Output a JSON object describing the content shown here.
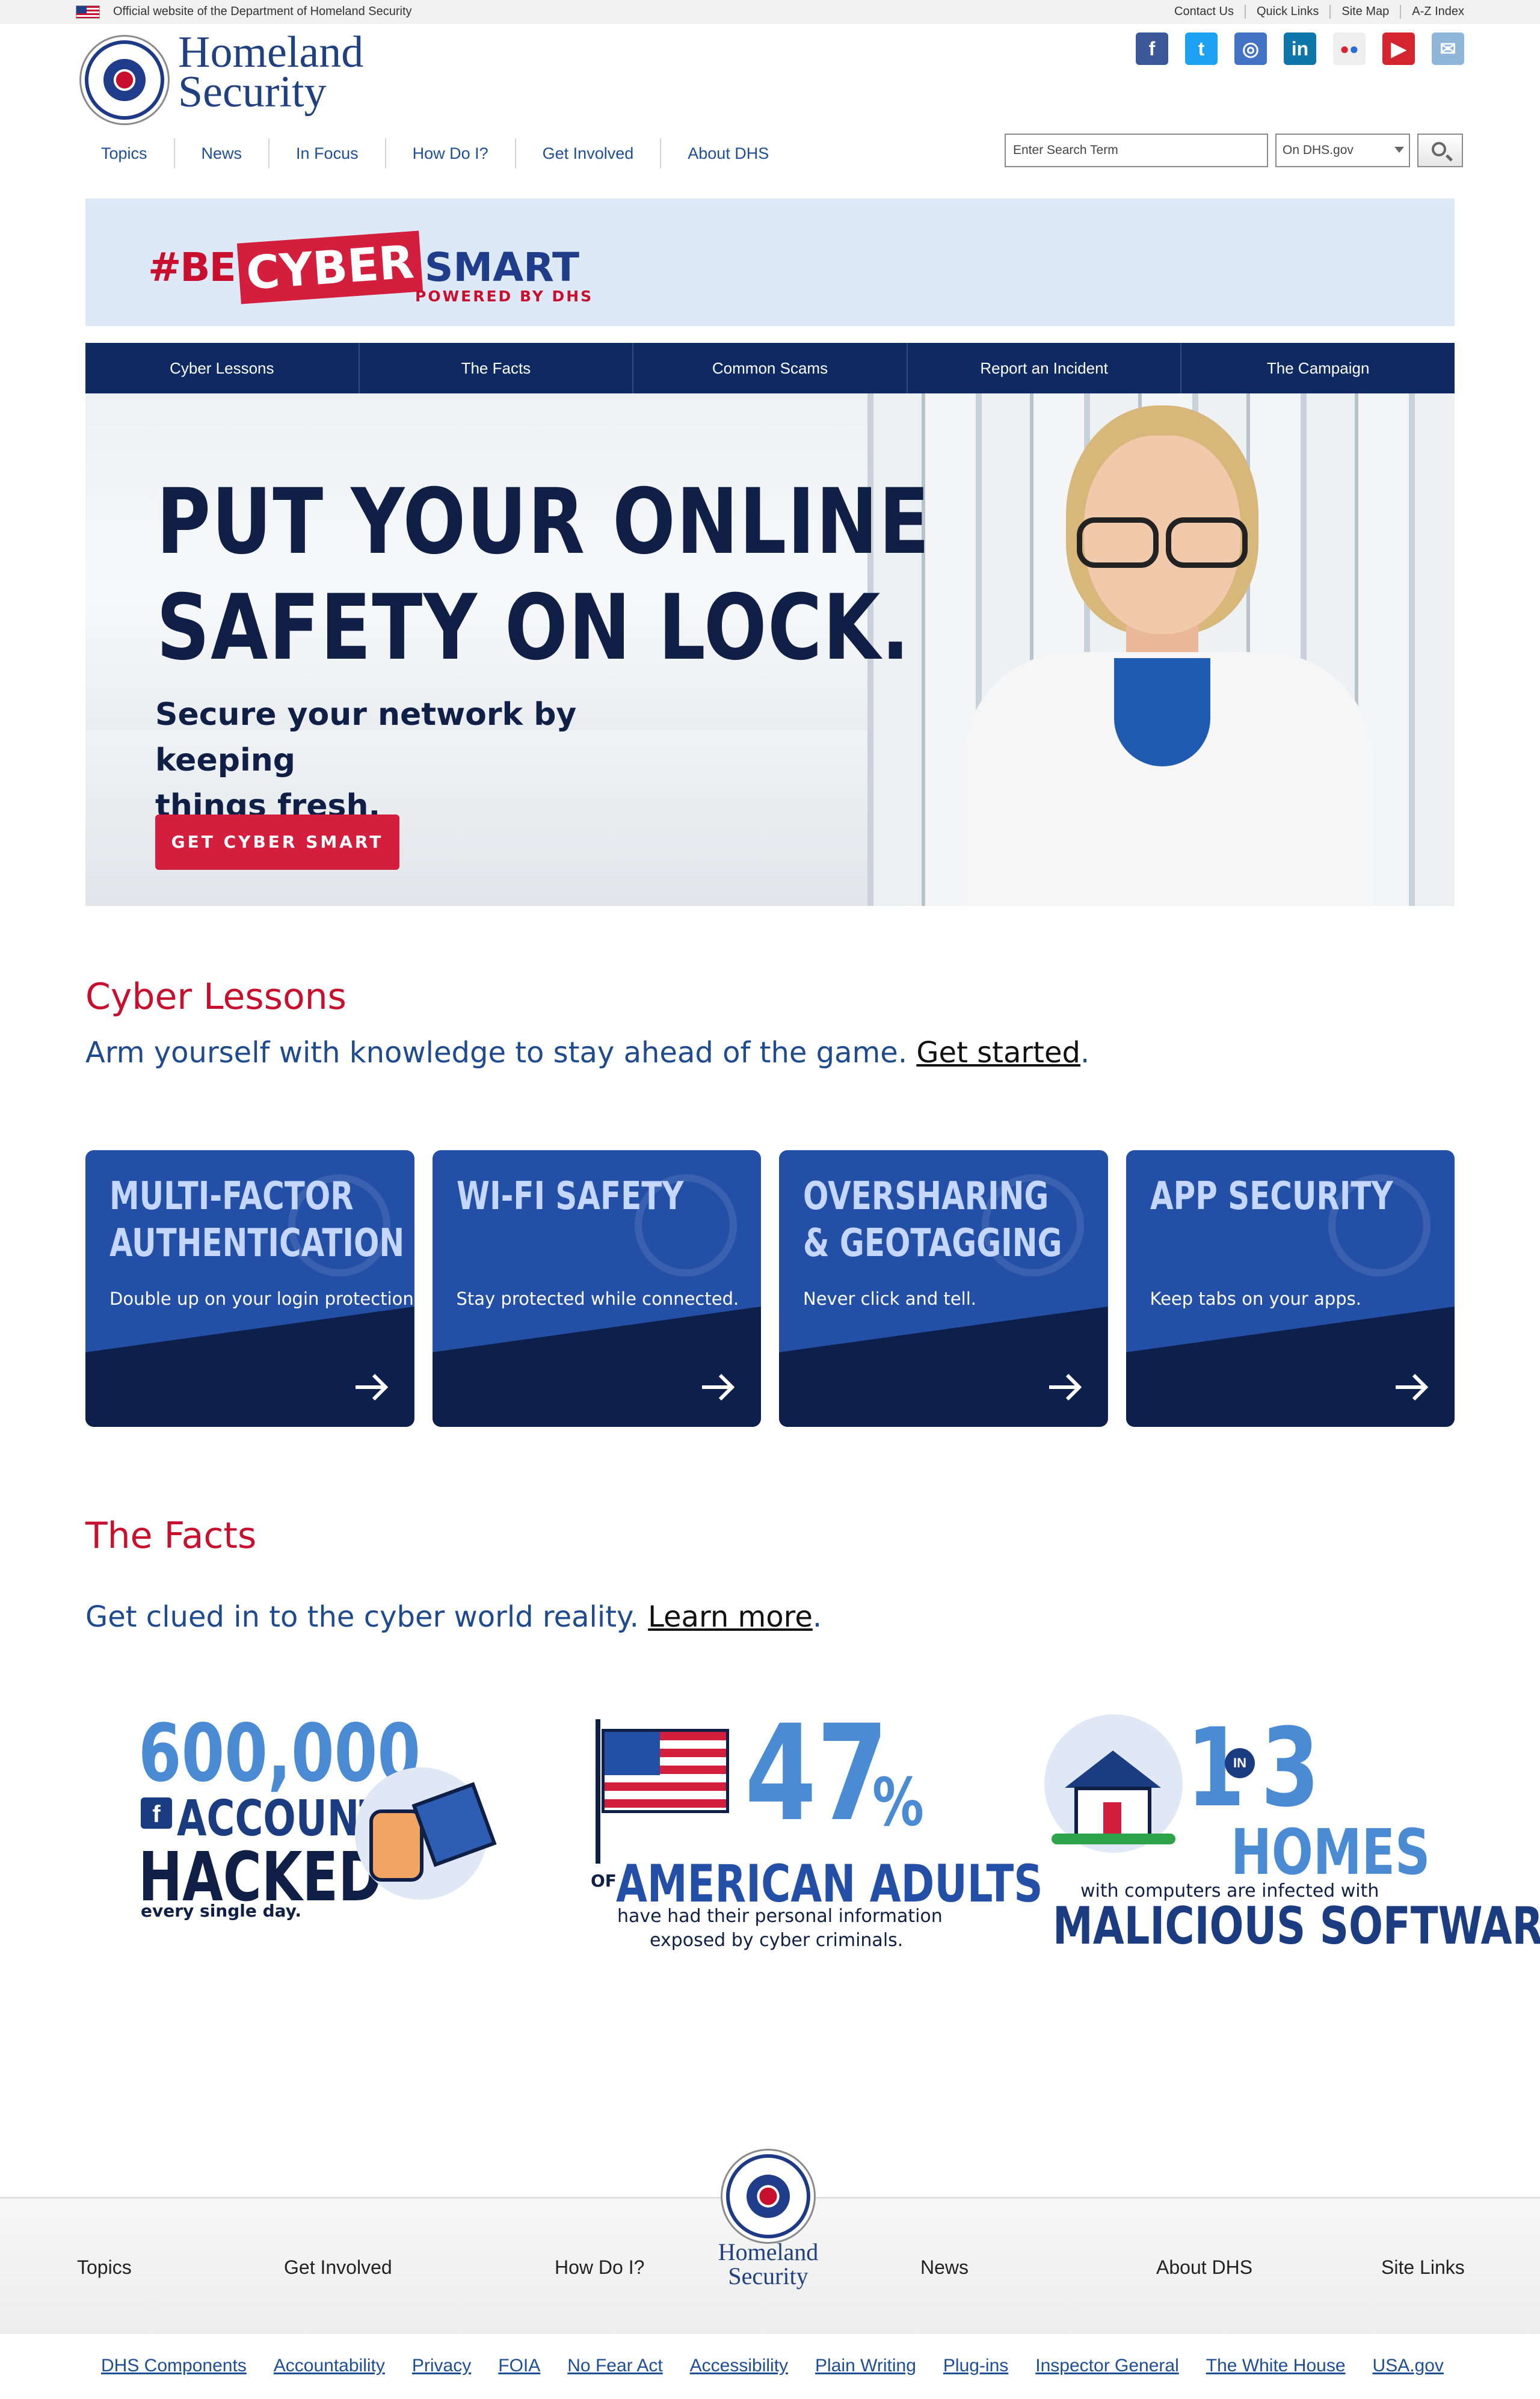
{
  "utility": {
    "official_text": "Official website of the Department of Homeland Security",
    "links": [
      "Contact Us",
      "Quick Links",
      "Site Map",
      "A-Z Index"
    ]
  },
  "header": {
    "wordmark_line1": "Homeland",
    "wordmark_line2": "Security",
    "nav": [
      "Topics",
      "News",
      "In Focus",
      "How Do I?",
      "Get Involved",
      "About DHS"
    ],
    "search": {
      "placeholder": "Enter Search Term",
      "scope": "On DHS.gov"
    },
    "social_icons": [
      "facebook-icon",
      "twitter-icon",
      "instagram-icon",
      "linkedin-icon",
      "flickr-icon",
      "youtube-icon",
      "email-icon"
    ],
    "social_colors": [
      "#3b5998",
      "#1da1f2",
      "#4472c4",
      "#0e76a8",
      "#eeeeee",
      "#d4252e",
      "#8fb5d9"
    ]
  },
  "campaign": {
    "hash": "#BE",
    "cyber": "CYBER",
    "smart": "SMART",
    "powered": "POWERED BY DHS",
    "nav": [
      "Cyber Lessons",
      "The Facts",
      "Common Scams",
      "Report an Incident",
      "The Campaign"
    ]
  },
  "hero": {
    "headline_1": "PUT YOUR ONLINE",
    "headline_2": "SAFETY ON LOCK.",
    "sub_1": "Secure your network by keeping",
    "sub_2": "things fresh.",
    "cta": "GET CYBER SMART"
  },
  "lessons": {
    "title": "Cyber Lessons",
    "intro": "Arm yourself with knowledge to stay ahead of the game.",
    "link": "Get started",
    "tail": ".",
    "cards": [
      {
        "title_1": "MULTI-FACTOR",
        "title_2": "AUTHENTICATION",
        "text": "Double up on your login protection."
      },
      {
        "title_1": "WI-FI SAFETY",
        "title_2": "",
        "text": "Stay protected while connected."
      },
      {
        "title_1": "OVERSHARING",
        "title_2": "& GEOTAGGING",
        "text": "Never click and tell."
      },
      {
        "title_1": "APP SECURITY",
        "title_2": "",
        "text": "Keep tabs on your apps."
      }
    ]
  },
  "facts": {
    "title": "The Facts",
    "intro": "Get clued in to the cyber world reality.",
    "link": "Learn more",
    "tail": ".",
    "fact1": {
      "number": "600,000",
      "line1": "ACCOUNTS",
      "line2": "HACKED",
      "line3": "every single day."
    },
    "fact2": {
      "number": "47",
      "pct": "%",
      "of": "OF",
      "line1": "AMERICAN ADULTS",
      "line2": "have had their personal information",
      "line3": "exposed by cyber criminals."
    },
    "fact3": {
      "one": "1",
      "in": "IN",
      "three": "3",
      "homes": "HOMES",
      "line1": "with computers are infected with",
      "line2": "MALICIOUS SOFTWARE"
    }
  },
  "footer": {
    "nav_left": [
      "Topics",
      "Get Involved",
      "How Do I?"
    ],
    "nav_right": [
      "News",
      "About DHS",
      "Site Links"
    ],
    "wordmark_line1": "Homeland",
    "wordmark_line2": "Security",
    "legal": [
      "DHS Components",
      "Accountability",
      "Privacy",
      "FOIA",
      "No Fear Act",
      "Accessibility",
      "Plain Writing",
      "Plug-ins",
      "Inspector General",
      "The White House",
      "USA.gov"
    ]
  },
  "colors": {
    "brand_red": "#c8102e",
    "navy": "#0f2a63",
    "card_blue": "#2350a6",
    "link_blue": "#1d4e96"
  }
}
